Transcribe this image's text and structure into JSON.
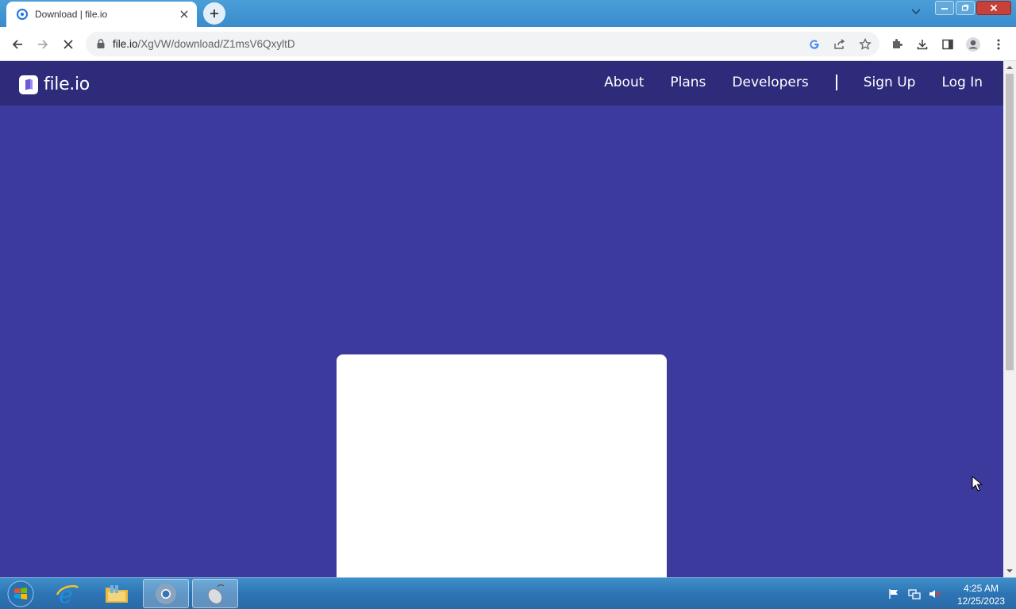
{
  "browser": {
    "tab": {
      "title": "Download | file.io"
    },
    "address": {
      "host": "file.io",
      "path": "/XgVW/download/Z1msV6QxyltD"
    }
  },
  "site": {
    "brand": "file.io",
    "nav": {
      "about": "About",
      "plans": "Plans",
      "developers": "Developers",
      "signup": "Sign Up",
      "login": "Log In"
    },
    "colors": {
      "nav_bg": "#2e2b7a",
      "page_bg": "#3d3a9e"
    }
  },
  "taskbar": {
    "clock": {
      "time": "4:25 AM",
      "date": "12/25/2023"
    }
  }
}
